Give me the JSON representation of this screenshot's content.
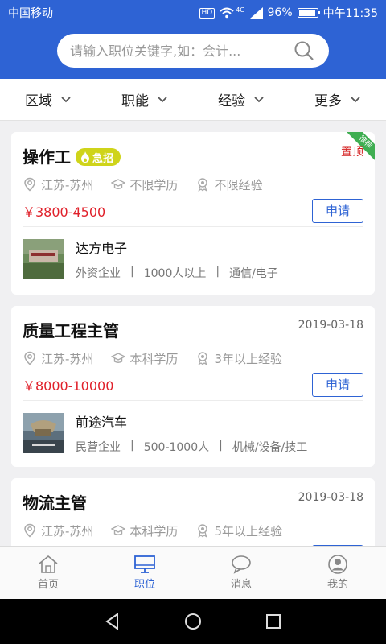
{
  "status": {
    "carrier": "中国移动",
    "hd": "HD",
    "net": "4G",
    "battery": "96%",
    "time": "中午11:35"
  },
  "search": {
    "placeholder": "请输入职位关键字,如：会计..."
  },
  "filters": [
    {
      "label": "区域"
    },
    {
      "label": "职能"
    },
    {
      "label": "经验"
    },
    {
      "label": "更多"
    }
  ],
  "jobs": [
    {
      "title": "操作工",
      "urgent": "急招",
      "pin": "置顶",
      "ribbon": "推荐",
      "location": "江苏-苏州",
      "education": "不限学历",
      "experience": "不限经验",
      "salary": "￥3800-4500",
      "apply": "申请",
      "company": "达方电子",
      "company_type": "外资企业",
      "company_size": "1000人以上",
      "industry": "通信/电子"
    },
    {
      "title": "质量工程主管",
      "date": "2019-03-18",
      "location": "江苏-苏州",
      "education": "本科学历",
      "experience": "3年以上经验",
      "salary": "￥8000-10000",
      "apply": "申请",
      "company": "前途汽车",
      "company_type": "民营企业",
      "company_size": "500-1000人",
      "industry": "机械/设备/技工"
    },
    {
      "title": "物流主管",
      "date": "2019-03-18",
      "location": "江苏-苏州",
      "education": "本科学历",
      "experience": "5年以上经验"
    }
  ],
  "tabs": [
    {
      "label": "首页"
    },
    {
      "label": "职位"
    },
    {
      "label": "消息"
    },
    {
      "label": "我的"
    }
  ],
  "colors": {
    "primary": "#2e63d4",
    "salary": "#e0202a",
    "urgent": "#cfd41a",
    "ribbon": "#3fae52"
  }
}
